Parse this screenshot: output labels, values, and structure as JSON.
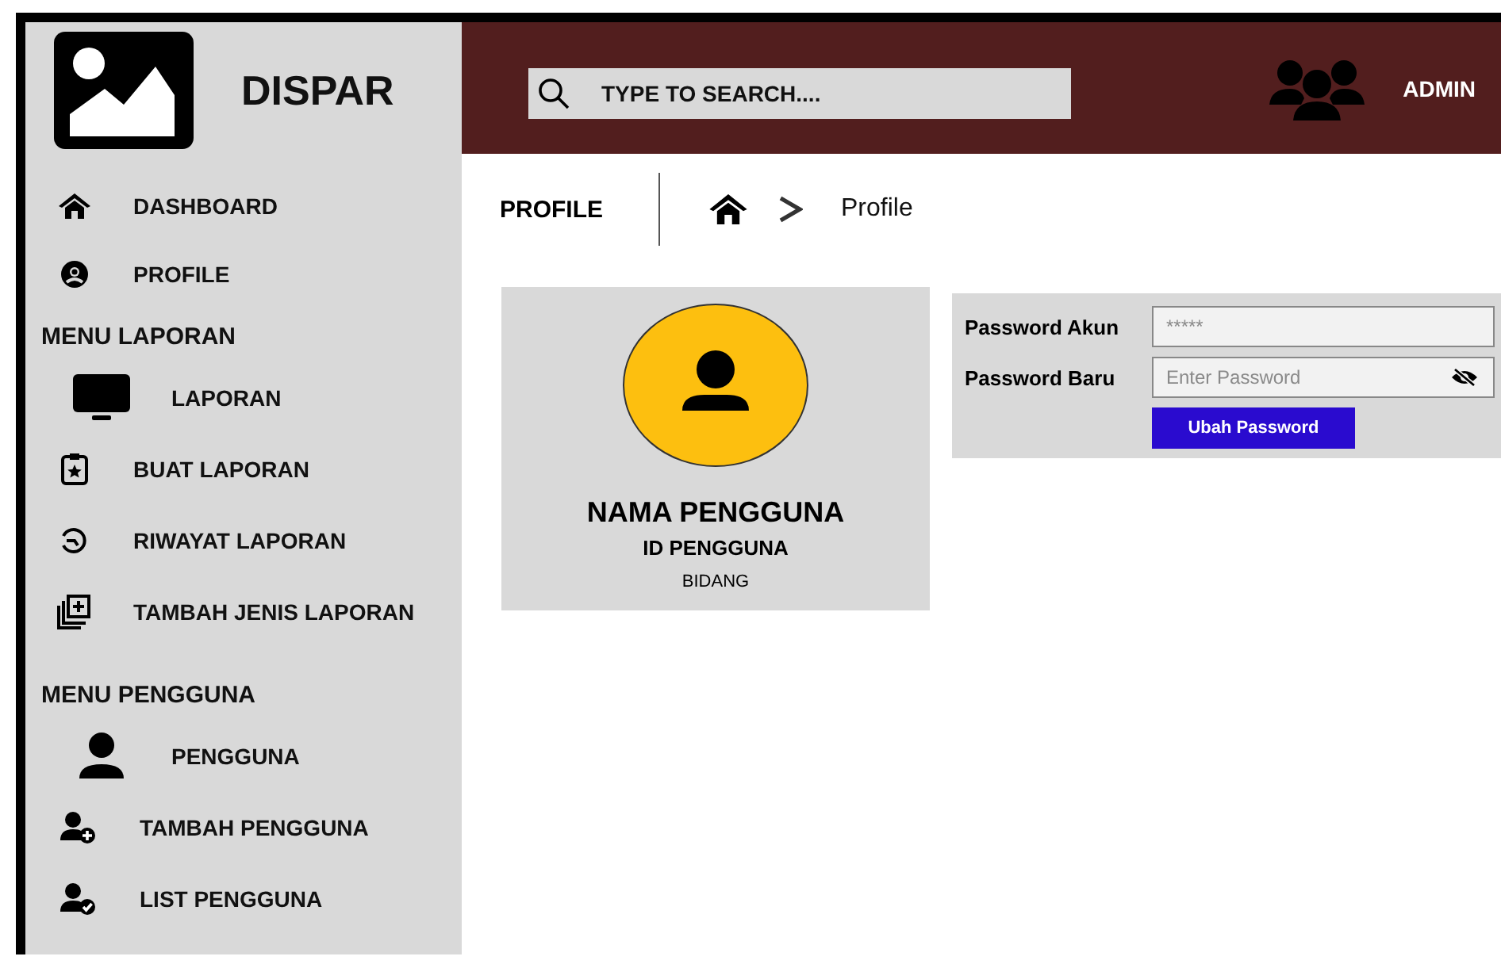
{
  "brand": {
    "name": "DISPAR"
  },
  "sidebar": {
    "groups": [
      {
        "items": [
          {
            "label": "DASHBOARD",
            "kind": "home"
          },
          {
            "label": "PROFILE",
            "kind": "profile"
          }
        ]
      },
      {
        "heading": "MENU LAPORAN",
        "items": [
          {
            "label": "LAPORAN",
            "kind": "monitor"
          },
          {
            "label": "BUAT LAPORAN",
            "kind": "clipboard"
          },
          {
            "label": "RIWAYAT LAPORAN",
            "kind": "history"
          },
          {
            "label": "TAMBAH JENIS LAPORAN",
            "kind": "add-stack"
          }
        ]
      },
      {
        "heading": "MENU PENGGUNA",
        "items": [
          {
            "label": "PENGGUNA",
            "kind": "person"
          },
          {
            "label": "TAMBAH PENGGUNA",
            "kind": "person-add"
          },
          {
            "label": "LIST PENGGUNA",
            "kind": "person-check"
          }
        ]
      }
    ]
  },
  "header": {
    "search": {
      "placeholder": "TYPE TO SEARCH...."
    },
    "user": "ADMIN"
  },
  "page": {
    "title": "PROFILE",
    "breadcrumb": "Profile"
  },
  "profile_card": {
    "name": "NAMA PENGGUNA",
    "id": "ID PENGGUNA",
    "division": "BIDANG"
  },
  "password_form": {
    "fields": [
      {
        "label": "Password Akun",
        "placeholder": "*****",
        "kind": "plain"
      },
      {
        "label": "Password Baru",
        "placeholder": "Enter Password",
        "kind": "reveal"
      }
    ],
    "button": "Ubah Password"
  }
}
